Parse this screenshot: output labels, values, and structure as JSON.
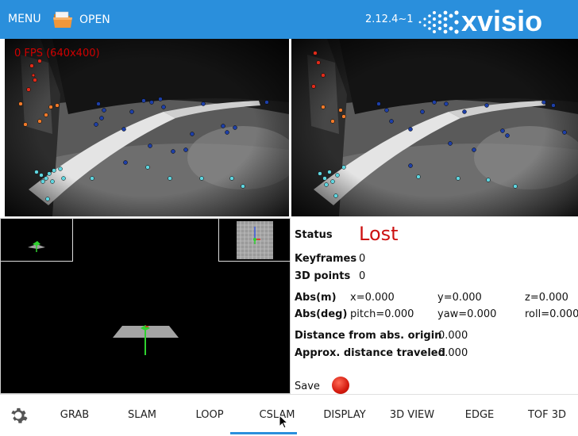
{
  "topbar": {
    "menu_label": "MENU",
    "open_label": "OPEN",
    "version": "2.12.4~1",
    "logo_text": "xvisio",
    "accent_color": "#2a8fdc"
  },
  "camera": {
    "fps_text": "0 FPS (640x400)"
  },
  "status": {
    "status_label": "Status",
    "status_value": "Lost",
    "keyframes_label": "Keyframes",
    "keyframes_value": "0",
    "points_label": "3D points",
    "points_value": "0",
    "abs_m_label": "Abs(m)",
    "x_value": "x=0.000",
    "y_value": "y=0.000",
    "z_value": "z=0.000",
    "abs_deg_label": "Abs(deg)",
    "pitch_value": "pitch=0.000",
    "yaw_value": "yaw=0.000",
    "roll_value": "roll=0.000",
    "dist_origin_label": "Distance from abs. origin",
    "dist_origin_value": "0.000",
    "dist_traveled_label": "Approx. distance traveled",
    "dist_traveled_value": "0.000",
    "save_label": "Save"
  },
  "tabs": [
    {
      "label": "GRAB"
    },
    {
      "label": "SLAM"
    },
    {
      "label": "LOOP"
    },
    {
      "label": "CSLAM"
    },
    {
      "label": "DISPLAY"
    },
    {
      "label": "3D VIEW"
    },
    {
      "label": "EDGE"
    },
    {
      "label": "TOF 3D"
    }
  ],
  "icons": {
    "settings": "gear-icon",
    "open": "folder-icon",
    "record": "record-icon"
  }
}
